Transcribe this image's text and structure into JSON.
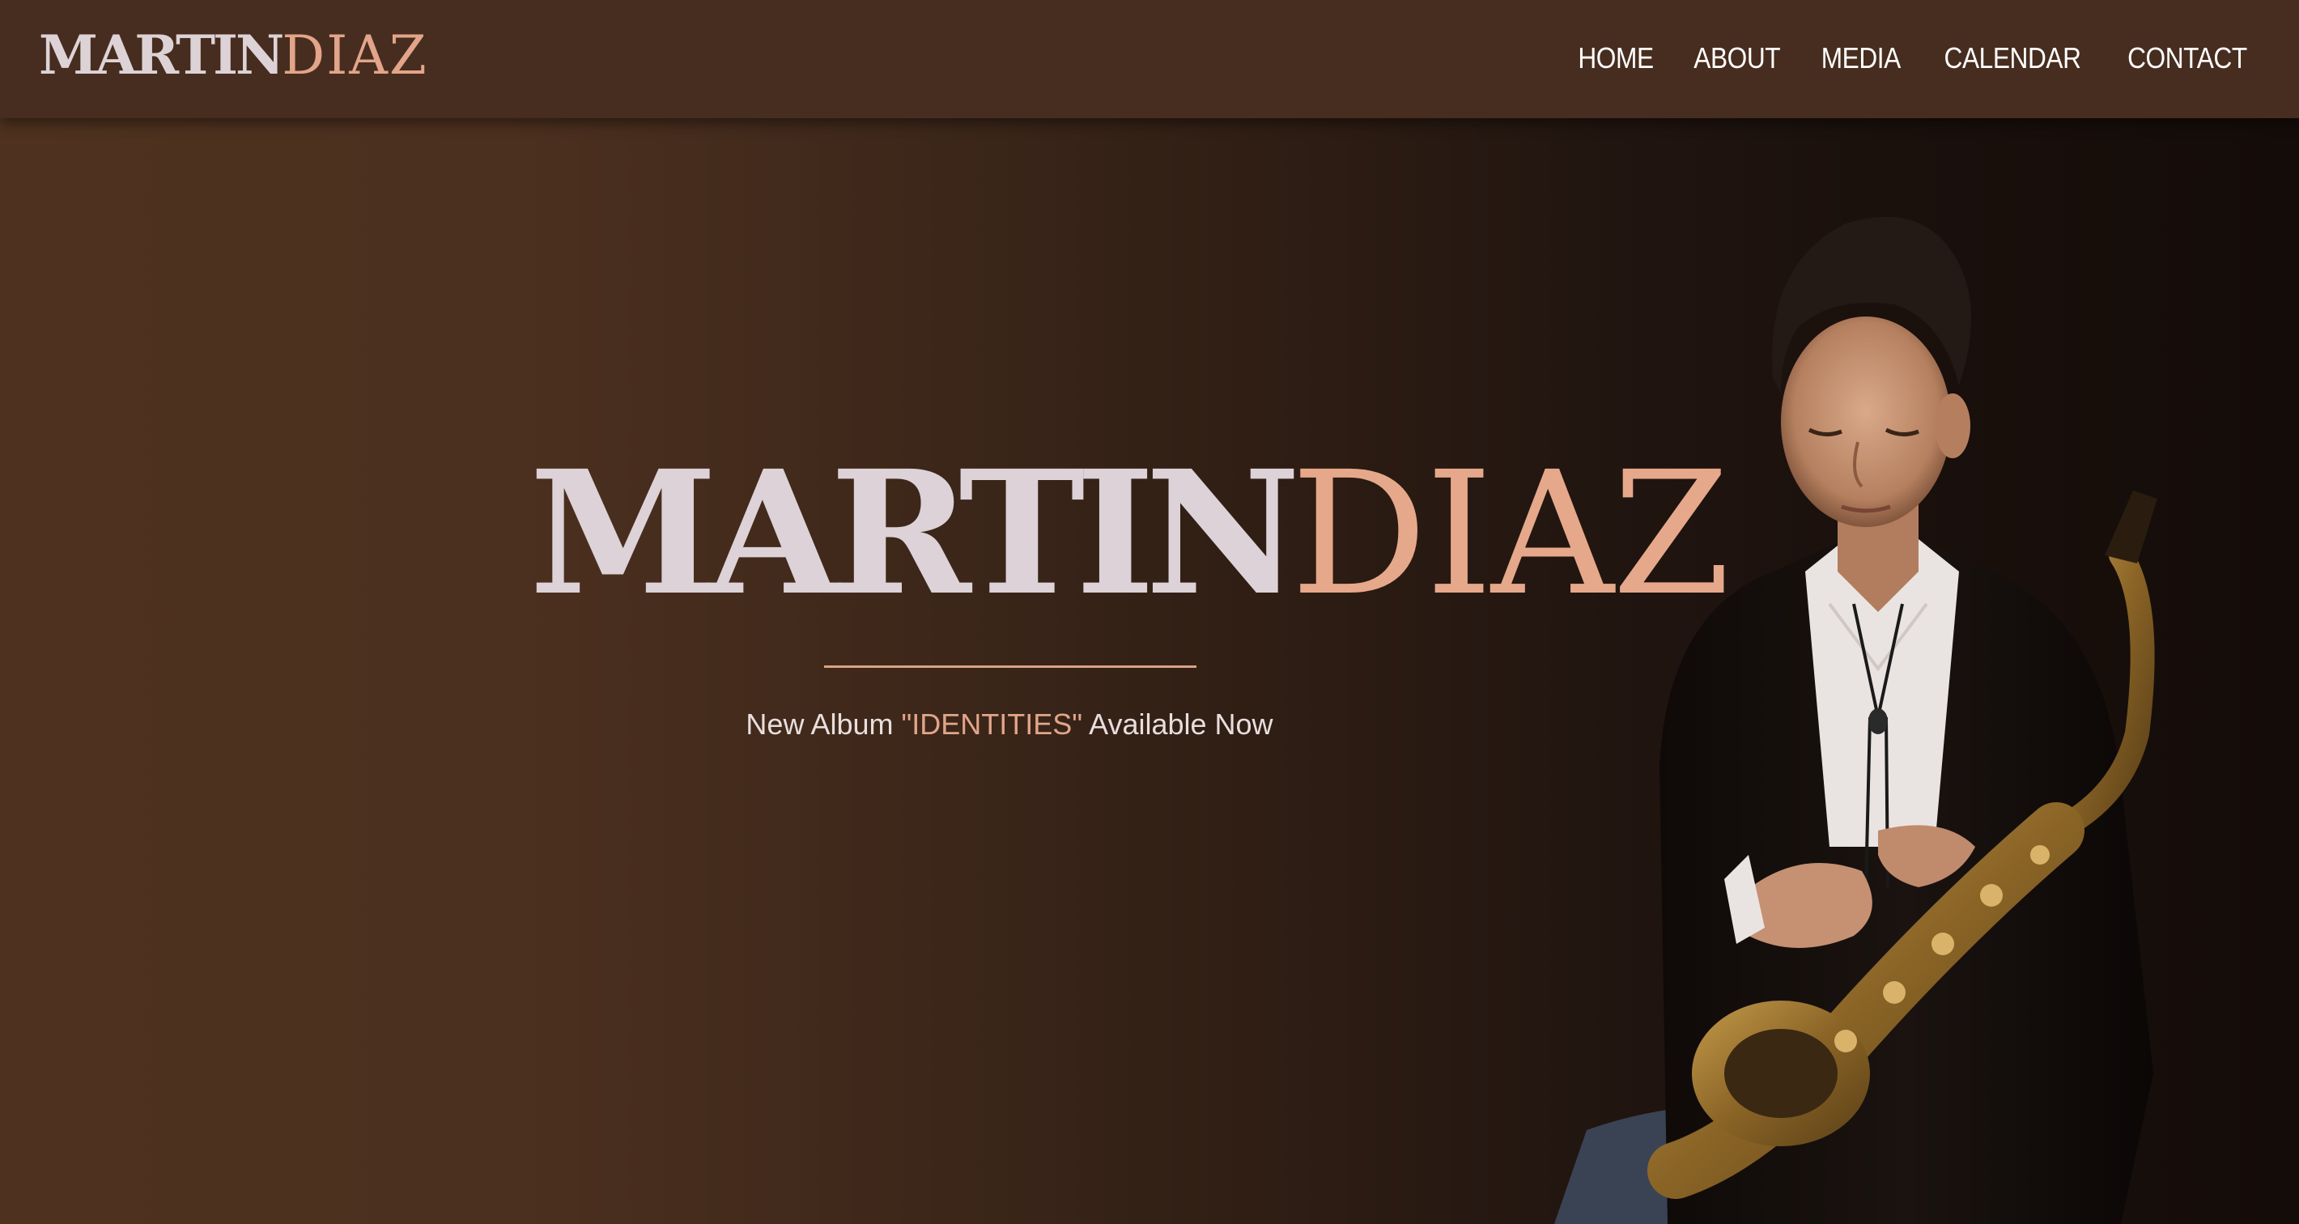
{
  "header": {
    "logo_first": "MARTIN",
    "logo_last": "DIAZ",
    "nav": [
      {
        "label": "HOME"
      },
      {
        "label": "ABOUT"
      },
      {
        "label": "MEDIA"
      },
      {
        "label": "CALENDAR"
      },
      {
        "label": "CONTACT"
      }
    ]
  },
  "hero": {
    "title_first": "MARTIN",
    "title_last": "DIAZ",
    "tagline_prefix": "New Album ",
    "tagline_album": "\"IDENTITIES\"",
    "tagline_suffix": " Available Now"
  },
  "colors": {
    "header_bg": "#472d1f",
    "accent": "#e2a589",
    "title_light": "#dcd2d7",
    "hero_dark": "#140c09"
  }
}
